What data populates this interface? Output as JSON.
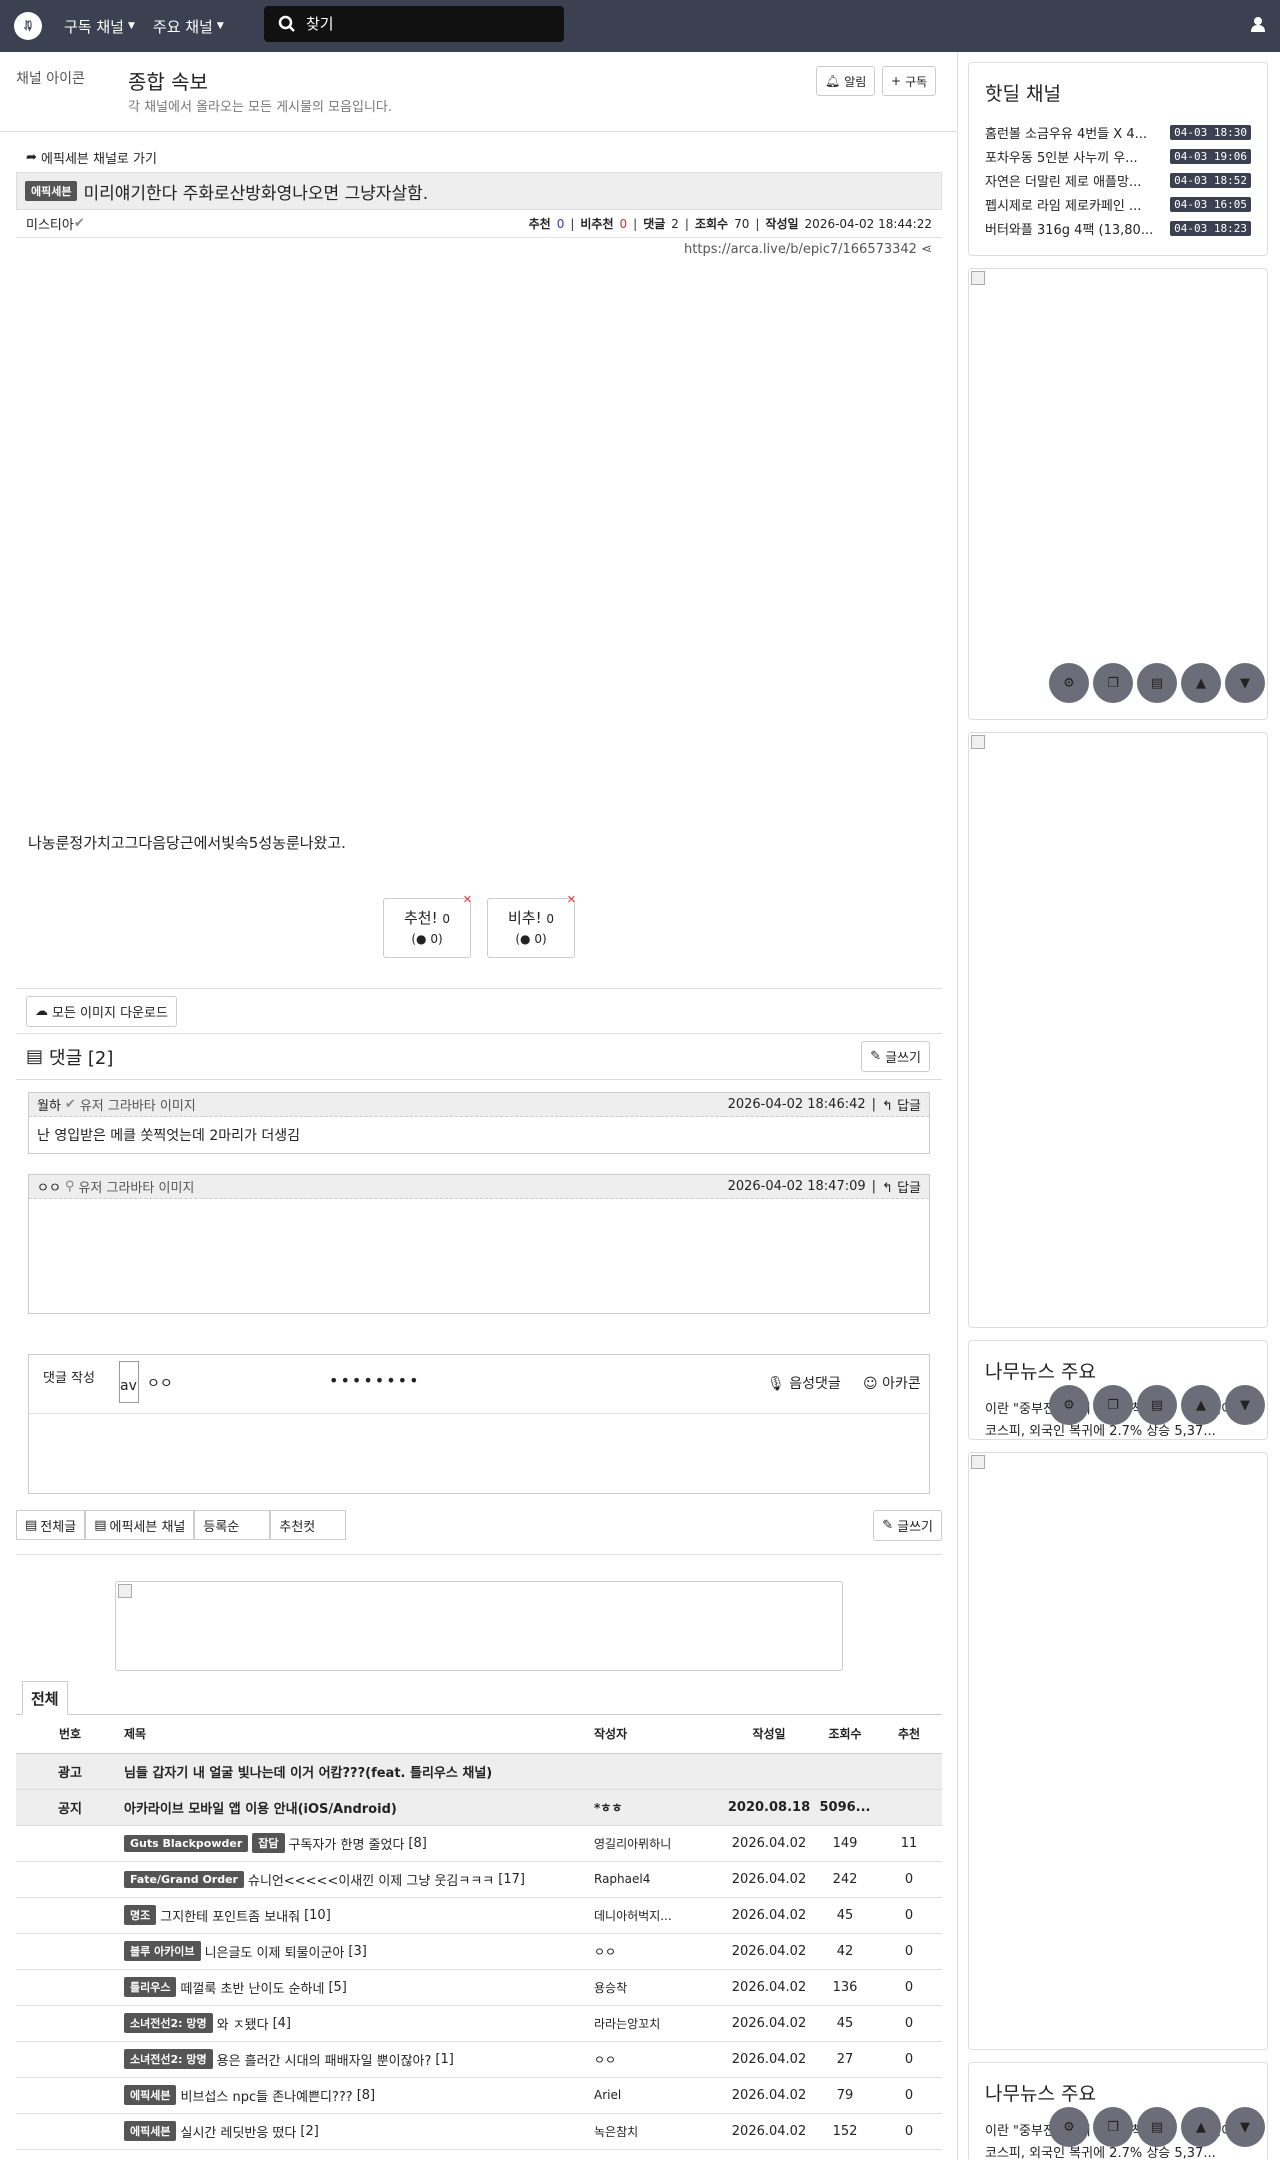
{
  "nav": {
    "menu1": "구독 채널",
    "menu2": "주요 채널",
    "search_placeholder": "찾기"
  },
  "channel": {
    "icon_alt": "채널 아이콘",
    "title": "종합 속보",
    "desc": "각 채널에서 올라오는 모든 게시물의 모음입니다.",
    "alert_btn": "알림",
    "subscribe_btn": "구독"
  },
  "article": {
    "back": "에픽세븐 채널로 가기",
    "badge": "에픽세븐",
    "title": "미리얘기한다 주화로산방화영나오면 그냥자살함.",
    "author": "미스티아",
    "rec_label": "추천",
    "rec": "0",
    "unrec_label": "비추천",
    "unrec": "0",
    "cmt_label": "댓글",
    "cmt": "2",
    "view_label": "조회수",
    "view": "70",
    "date_label": "작성일",
    "date": "2026-04-02 18:44:22",
    "url": "https://arca.live/b/epic7/166573342",
    "body": "나농룬정가치고그다음당근에서빛속5성농룬나왔고.",
    "vote_up": "추천!",
    "vote_up_count": "0",
    "vote_up_sub": "0",
    "vote_down": "비추!",
    "vote_down_count": "0",
    "vote_down_sub": "0",
    "download_all": "모든 이미지 다운로드"
  },
  "comments": {
    "header": "댓글 [2]",
    "write_btn": "글쓰기",
    "items": [
      {
        "author": "월하",
        "avatar_alt": "유저 그라바타 이미지",
        "date": "2026-04-02 18:46:42",
        "reply": "답글",
        "text": "난 영입받은 메클 쏫찍엇는데 2마리가 더생김"
      },
      {
        "author": "ㅇㅇ",
        "avatar_alt": "유저 그라바타 이미지",
        "date": "2026-04-02 18:47:09",
        "reply": "답글",
        "text": ""
      }
    ],
    "form": {
      "label": "댓글 작성",
      "avatar": "av",
      "nickname": "ㅇㅇ",
      "password": "••••••••",
      "voice": "음성댓글",
      "arcacon": "아카콘"
    }
  },
  "board": {
    "tab_all": "전체글",
    "tab_channel": "에픽세븐 채널",
    "tab_order": "등록순",
    "tab_rec": "추천컷",
    "write_btn": "글쓰기",
    "list_tab": "전체",
    "columns": {
      "no": "번호",
      "title": "제목",
      "author": "작성자",
      "date": "작성일",
      "view": "조회수",
      "rec": "추천"
    },
    "rows": [
      {
        "no": "광고",
        "badges": [],
        "title": "님들 갑자기 내 얼굴 빛나는데 이거 어캄???(feat. 틀리우스 채널)",
        "cmt": "",
        "author": "",
        "date": "",
        "view": "",
        "rec": "",
        "notice": true
      },
      {
        "no": "공지",
        "badges": [],
        "title": "아카라이브 모바일 앱 이용 안내(iOS/Android)",
        "cmt": "",
        "author": "*ㅎㅎ",
        "date": "2020.08.18",
        "view": "5096...",
        "rec": "",
        "notice": true
      },
      {
        "no": "",
        "badges": [
          "Guts Blackpowder",
          "잡담"
        ],
        "title": "구독자가 한명 줄었다",
        "cmt": "[8]",
        "author": "영길리아뮈하니",
        "date": "2026.04.02",
        "view": "149",
        "rec": "11",
        "notice": false
      },
      {
        "no": "",
        "badges": [
          "Fate/Grand Order"
        ],
        "title": "슈니언<<<<<이새낀 이제 그냥 웃김ㅋㅋㅋ",
        "cmt": "[17]",
        "author": "Raphael4",
        "date": "2026.04.02",
        "view": "242",
        "rec": "0",
        "notice": false
      },
      {
        "no": "",
        "badges": [
          "명조"
        ],
        "title": "그지한테 포인트좀 보내줘",
        "cmt": "[10]",
        "author": "데니아허벅지...",
        "date": "2026.04.02",
        "view": "45",
        "rec": "0",
        "notice": false
      },
      {
        "no": "",
        "badges": [
          "블루 아카이브"
        ],
        "title": "니은글도 이제 퇴물이군아",
        "cmt": "[3]",
        "author": "ㅇㅇ",
        "date": "2026.04.02",
        "view": "42",
        "rec": "0",
        "notice": false
      },
      {
        "no": "",
        "badges": [
          "틀리우스"
        ],
        "title": "떼껄룩 초반 난이도 순하네",
        "cmt": "[5]",
        "author": "용승착",
        "date": "2026.04.02",
        "view": "136",
        "rec": "0",
        "notice": false
      },
      {
        "no": "",
        "badges": [
          "소녀전선2: 망명"
        ],
        "title": "와 ㅈ됐다",
        "cmt": "[4]",
        "author": "라라는앙꼬치",
        "date": "2026.04.02",
        "view": "45",
        "rec": "0",
        "notice": false
      },
      {
        "no": "",
        "badges": [
          "소녀전선2: 망명"
        ],
        "title": "용은 흘러간 시대의 패배자일 뿐이잖아?",
        "cmt": "[1]",
        "author": "ㅇㅇ",
        "date": "2026.04.02",
        "view": "27",
        "rec": "0",
        "notice": false
      },
      {
        "no": "",
        "badges": [
          "에픽세븐"
        ],
        "title": "비브섭스 npc들 존나예쁜디???",
        "cmt": "[8]",
        "author": "Ariel",
        "date": "2026.04.02",
        "view": "79",
        "rec": "0",
        "notice": false
      },
      {
        "no": "",
        "badges": [
          "에픽세븐"
        ],
        "title": "실시간 레딧반응 떴다",
        "cmt": "[2]",
        "author": "녹은참치",
        "date": "2026.04.02",
        "view": "152",
        "rec": "0",
        "notice": false
      }
    ]
  },
  "sidebar": {
    "hotdeal_title": "핫딜 채널",
    "hotdeals": [
      {
        "title": "홈런볼 소금우유 4번들 X 4...",
        "time": "04-03 18:30"
      },
      {
        "title": "포차우동 5인분 사누끼 우...",
        "time": "04-03 19:06"
      },
      {
        "title": "자연은 더말린 제로 애플망...",
        "time": "04-03 18:52"
      },
      {
        "title": "펩시제로 라임 제로카페인 ...",
        "time": "04-03 16:05"
      },
      {
        "title": "버터와플 316g 4팩 (13,80...",
        "time": "04-03 18:23"
      }
    ],
    "news1_title": "나무뉴스 주요",
    "news1": [
      "이란 \"중부전선에서 미국 3척 출항\" 주장 이어...",
      "코스피, 외국인 복귀에 2.7% 상승 5,37..."
    ],
    "news2_title": "나무뉴스 주요",
    "news2": [
      "이란 \"중부전선에서 미국 3척 출항\" 주장 이어...",
      "코스피, 외국인 복귀에 2.7% 상승 5,37..."
    ]
  }
}
